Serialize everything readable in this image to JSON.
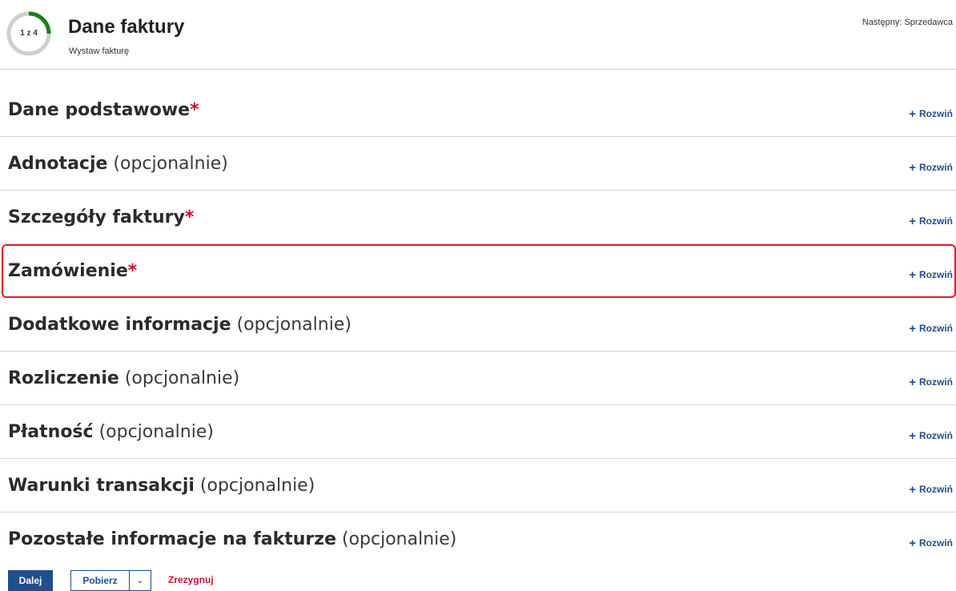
{
  "header": {
    "step_label": "1 z 4",
    "title": "Dane faktury",
    "subtitle": "Wystaw fakturę",
    "next": "Następny: Sprzedawca",
    "progress_fraction": 0.25,
    "progress_color": "#1a7f1a"
  },
  "sections": [
    {
      "name": "Dane podstawowe",
      "optional": "",
      "required": "*",
      "expand_label": "Rozwiń"
    },
    {
      "name": "Adnotacje",
      "optional": "(opcjonalnie)",
      "required": "",
      "expand_label": "Rozwiń"
    },
    {
      "name": "Szczegóły faktury",
      "optional": "",
      "required": "*",
      "expand_label": "Rozwiń"
    },
    {
      "name": "Zamówienie",
      "optional": "",
      "required": "*",
      "expand_label": "Rozwiń",
      "highlighted": true
    },
    {
      "name": "Dodatkowe informacje",
      "optional": "(opcjonalnie)",
      "required": "",
      "expand_label": "Rozwiń"
    },
    {
      "name": "Rozliczenie",
      "optional": "(opcjonalnie)",
      "required": "",
      "expand_label": "Rozwiń"
    },
    {
      "name": "Płatność",
      "optional": "(opcjonalnie)",
      "required": "",
      "expand_label": "Rozwiń"
    },
    {
      "name": "Warunki transakcji",
      "optional": "(opcjonalnie)",
      "required": "",
      "expand_label": "Rozwiń"
    },
    {
      "name": "Pozostałe informacje na fakturze",
      "optional": "(opcjonalnie)",
      "required": "",
      "expand_label": "Rozwiń"
    }
  ],
  "actions": {
    "next_label": "Dalej",
    "download_label": "Pobierz",
    "cancel_label": "Zrezygnuj"
  },
  "colors": {
    "accent": "#1f4f8f",
    "required": "#c8102e",
    "highlight": "#e31b23"
  }
}
